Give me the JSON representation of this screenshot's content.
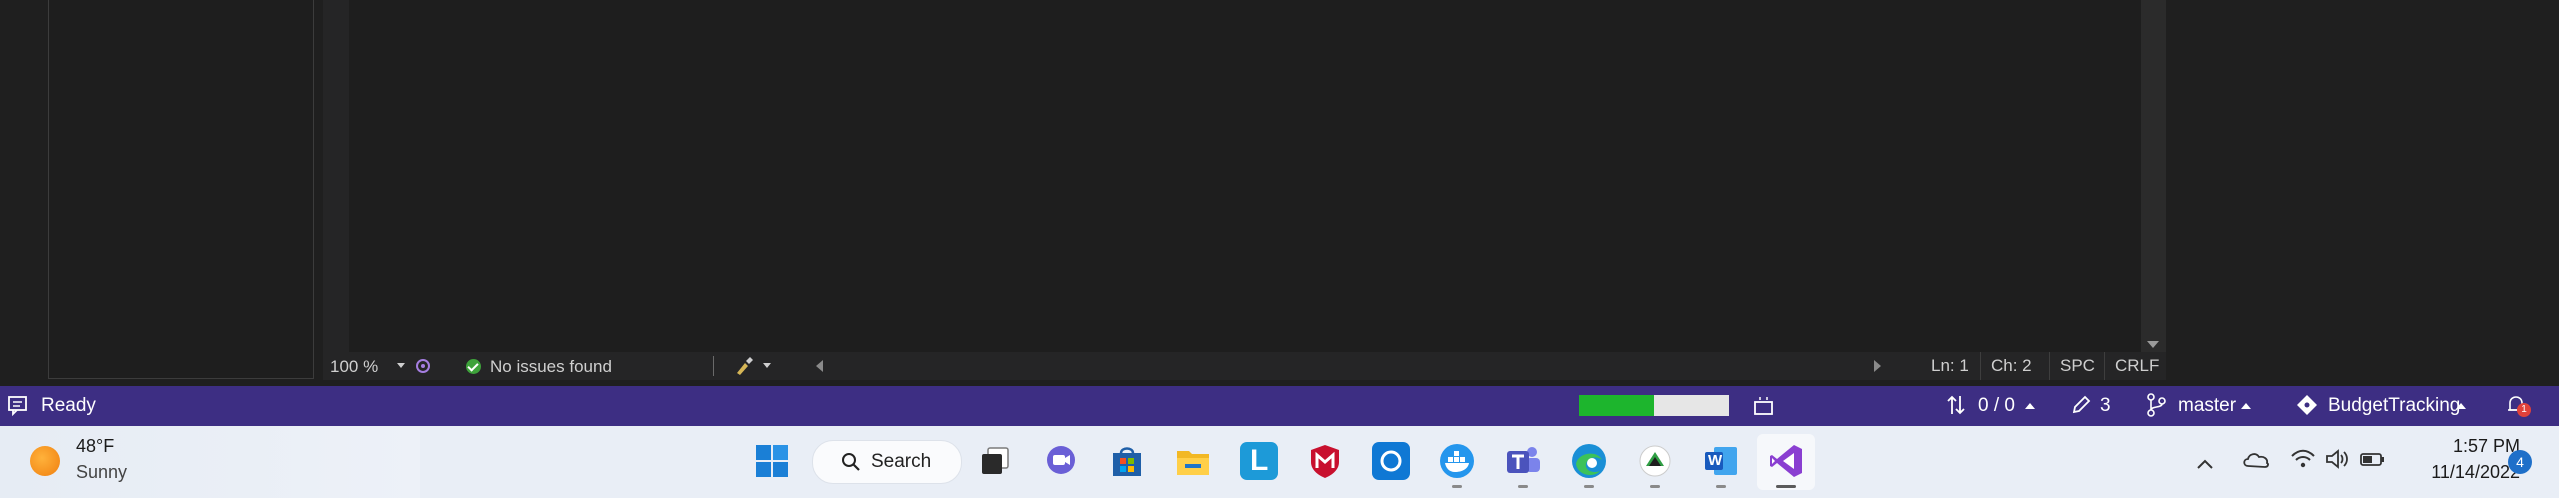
{
  "editor_bar": {
    "zoom": "100 %",
    "issues": "No issues found",
    "line": "Ln: 1",
    "char": "Ch: 2",
    "spacing": "SPC",
    "line_ending": "CRLF"
  },
  "status_bar": {
    "state": "Ready",
    "progress": 0.5,
    "errors": "0 / 0",
    "pending_changes": "3",
    "branch": "master",
    "repository": "BudgetTracking",
    "notifications": "1"
  },
  "taskbar": {
    "weather": {
      "temp": "48°F",
      "condition": "Sunny"
    },
    "search_label": "Search",
    "apps": [
      {
        "name": "windows-start-icon"
      },
      {
        "name": "task-view-icon"
      },
      {
        "name": "chat-icon"
      },
      {
        "name": "microsoft-store-icon"
      },
      {
        "name": "file-explorer-icon"
      },
      {
        "name": "l-app-icon",
        "label": "L"
      },
      {
        "name": "mcafee-icon"
      },
      {
        "name": "cortana-icon"
      },
      {
        "name": "docker-icon"
      },
      {
        "name": "teams-icon"
      },
      {
        "name": "edge-icon"
      },
      {
        "name": "app-icon"
      },
      {
        "name": "word-icon",
        "label": "W"
      },
      {
        "name": "visual-studio-icon"
      }
    ],
    "time": "1:57 PM",
    "date": "11/14/2022",
    "notification_count": "4"
  },
  "colors": {
    "status_bar": "#3d2e83",
    "progress_fill": "#1db52d",
    "taskbar": "#e9eef6"
  }
}
